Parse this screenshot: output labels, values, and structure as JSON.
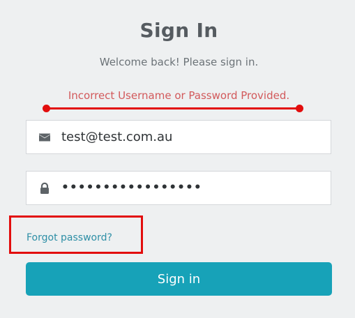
{
  "header": {
    "title": "Sign In",
    "subtitle": "Welcome back! Please sign in."
  },
  "alert": {
    "message": "Incorrect Username or Password Provided."
  },
  "form": {
    "email": {
      "icon": "envelope-icon",
      "value": "test@test.com.au"
    },
    "password": {
      "icon": "lock-icon",
      "value": "•••••••••••••••••"
    },
    "forgot_label": "Forgot password?",
    "submit_label": "Sign in"
  },
  "annotations": {
    "color": "#e20d0d"
  },
  "colors": {
    "background": "#eef0f1",
    "accent": "#17a2b8",
    "error": "#d2595b",
    "link": "#2e8fa6"
  }
}
